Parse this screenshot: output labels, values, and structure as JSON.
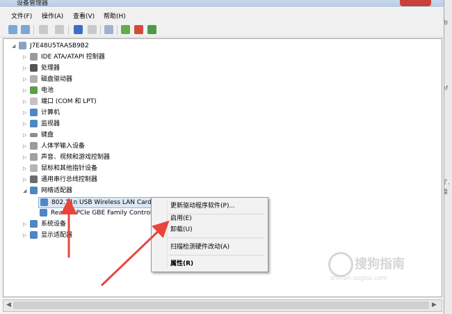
{
  "window": {
    "title": "设备管理器"
  },
  "menu": [
    "文件(F)",
    "操作(A)",
    "查看(V)",
    "帮助(H)"
  ],
  "tree": {
    "root": "J7E48U5TAASB9B2",
    "categories": [
      "IDE ATA/ATAPI 控制器",
      "处理器",
      "磁盘驱动器",
      "电池",
      "端口 (COM 和 LPT)",
      "计算机",
      "监视器",
      "键盘",
      "人体学输入设备",
      "声音、视频和游戏控制器",
      "鼠标和其他指针设备",
      "通用串行总线控制器",
      "网络适配器"
    ],
    "network_children": [
      "802.11n USB Wireless LAN Card",
      "Realtek PCIe GBE Family Controller"
    ],
    "after": [
      "系统设备",
      "显示适配器"
    ]
  },
  "context_menu": [
    "更新驱动程序软件(P)...",
    "启用(E)",
    "卸载(U)",
    "扫描检测硬件改动(A)",
    "属性(R)"
  ],
  "side_text": [
    "你",
    "nf",
    "了,",
    "盘"
  ],
  "watermark": {
    "brand": "搜狗指南",
    "url": "zhinan.sogou.com"
  },
  "colors": {
    "arrow": "#e8453c",
    "selection": "#dde8f6"
  }
}
